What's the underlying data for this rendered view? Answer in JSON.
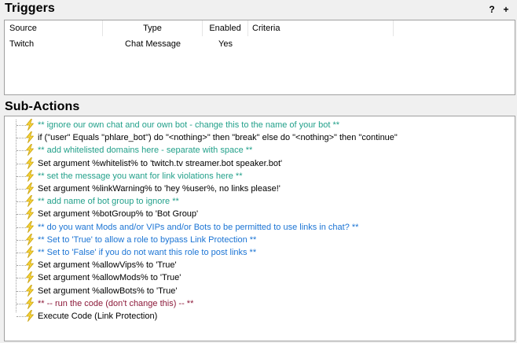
{
  "triggers": {
    "title": "Triggers",
    "help_label": "?",
    "add_label": "+",
    "columns": [
      "Source",
      "Type",
      "Enabled",
      "Criteria"
    ],
    "rows": [
      {
        "source": "Twitch",
        "type": "Chat Message",
        "enabled": "Yes",
        "criteria": ""
      }
    ]
  },
  "subactions": {
    "title": "Sub-Actions",
    "icon": "lightning-bolt-icon",
    "colors": {
      "green": "#22a08a",
      "blue": "#1b74d4",
      "maroon": "#8c1a3a",
      "black": "#000000"
    },
    "items": [
      {
        "text": "** ignore our own chat and our own bot - change this to the name of your bot **",
        "color": "green"
      },
      {
        "text": "if (\"user\" Equals \"phlare_bot\") do \"<nothing>\" then \"break\" else do \"<nothing>\" then \"continue\"",
        "color": "black"
      },
      {
        "text": "** add whitelisted domains here - separate with space **",
        "color": "green"
      },
      {
        "text": "Set argument %whitelist% to 'twitch.tv streamer.bot speaker.bot'",
        "color": "black"
      },
      {
        "text": "** set the message you want for link violations here **",
        "color": "green"
      },
      {
        "text": "Set argument %linkWarning% to 'hey %user%, no links please!'",
        "color": "black"
      },
      {
        "text": "** add name of bot group to ignore **",
        "color": "green"
      },
      {
        "text": "Set argument %botGroup% to 'Bot Group'",
        "color": "black"
      },
      {
        "text": "** do you want Mods and/or VIPs and/or Bots to be permitted to use links in chat? **",
        "color": "blue"
      },
      {
        "text": "** Set to 'True' to allow a role to bypass Link Protection **",
        "color": "blue"
      },
      {
        "text": "** Set to 'False' if you do not want this role to post links **",
        "color": "blue"
      },
      {
        "text": "Set argument %allowVips% to 'True'",
        "color": "black"
      },
      {
        "text": "Set argument %allowMods% to 'True'",
        "color": "black"
      },
      {
        "text": "Set argument %allowBots% to 'True'",
        "color": "black"
      },
      {
        "text": "** -- run the code (don't change this) -- **",
        "color": "maroon"
      },
      {
        "text": "Execute Code (Link Protection)",
        "color": "black"
      }
    ]
  }
}
